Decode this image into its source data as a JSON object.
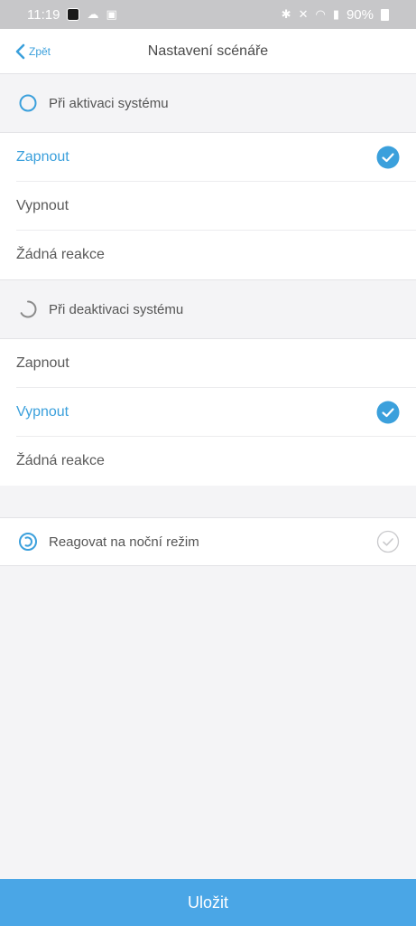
{
  "status_bar": {
    "time": "11:19",
    "battery": "90%"
  },
  "nav": {
    "back_label": "Zpět",
    "title": "Nastavení scénáře"
  },
  "sections": [
    {
      "title": "Při aktivaci systému",
      "options": [
        {
          "label": "Zapnout",
          "selected": true
        },
        {
          "label": "Vypnout",
          "selected": false
        },
        {
          "label": "Žádná reakce",
          "selected": false
        }
      ]
    },
    {
      "title": "Při deaktivaci systému",
      "options": [
        {
          "label": "Zapnout",
          "selected": false
        },
        {
          "label": "Vypnout",
          "selected": true
        },
        {
          "label": "Žádná reakce",
          "selected": false
        }
      ]
    }
  ],
  "night_mode": {
    "label": "Reagovat na noční režim",
    "enabled": false
  },
  "save_label": "Uložit",
  "colors": {
    "accent": "#3ba0dc",
    "save_button": "#4aa6e6",
    "background": "#f4f4f6"
  }
}
